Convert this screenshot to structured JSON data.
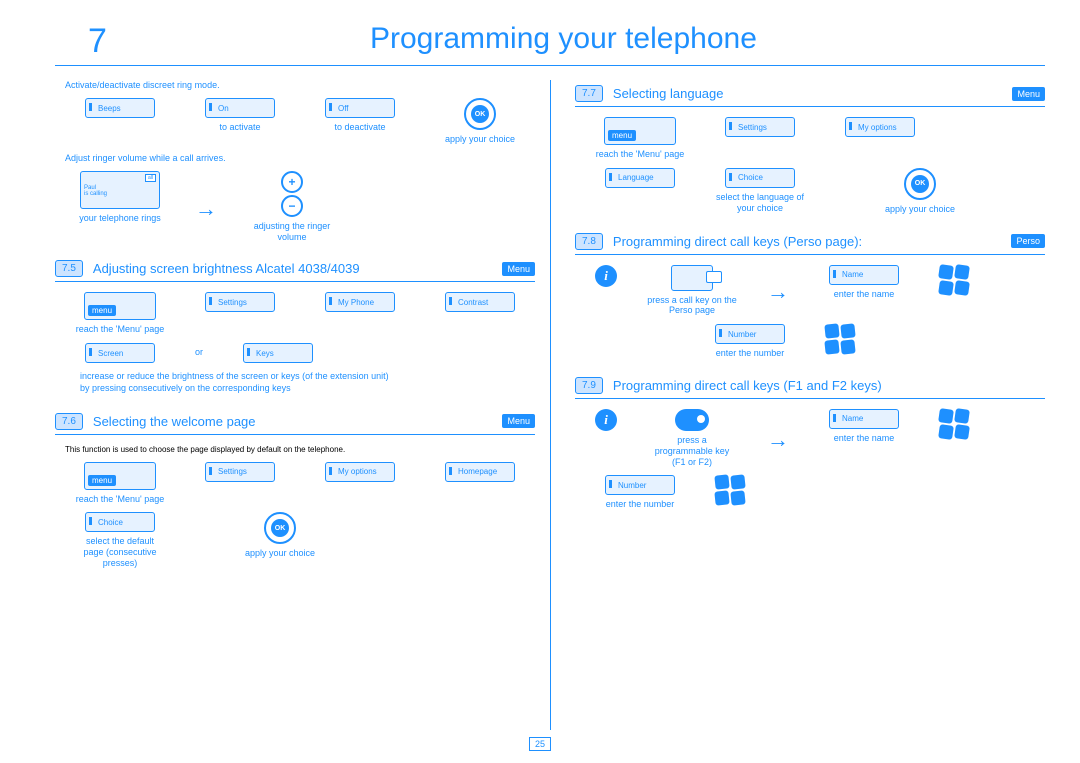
{
  "chapter": {
    "number": "7",
    "title": "Programming your telephone"
  },
  "page_number": "25",
  "left": {
    "note1": "Activate/deactivate discreet ring mode.",
    "r1": {
      "beeps": "Beeps",
      "on": "On",
      "off": "Off",
      "ok": "OK",
      "cap1": "to activate",
      "cap2": "to deactivate",
      "cap3": "apply your choice"
    },
    "note2": "Adjust ringer volume while a call arrives.",
    "r2": {
      "caller": "Paul\nis calling",
      "tab": "all",
      "cap1": "your telephone rings",
      "cap2": "adjusting the ringer volume"
    },
    "s75": {
      "num": "7.5",
      "title": "Adjusting screen brightness Alcatel 4038/4039",
      "tag": "Menu",
      "menu": "menu",
      "reach": "reach the 'Menu' page",
      "k1": "Settings",
      "k2": "My Phone",
      "k3": "Contrast",
      "k4": "Screen",
      "k5": "Keys",
      "or": "or",
      "desc": "increase or reduce the brightness of the screen or keys (of the extension unit) by pressing consecutively on the corresponding keys"
    },
    "s76": {
      "num": "7.6",
      "title": "Selecting the welcome page",
      "tag": "Menu",
      "desc": "This function is used to choose the page displayed by default on the telephone.",
      "menu": "menu",
      "reach": "reach the 'Menu' page",
      "k1": "Settings",
      "k2": "My options",
      "k3": "Homepage",
      "k4": "Choice",
      "cap1": "select the default page (consecutive presses)",
      "cap2": "apply your choice",
      "ok": "OK"
    }
  },
  "right": {
    "s77": {
      "num": "7.7",
      "title": "Selecting language",
      "tag": "Menu",
      "menu": "menu",
      "reach": "reach the 'Menu' page",
      "k1": "Settings",
      "k2": "My options",
      "k3": "Language",
      "k4": "Choice",
      "cap1": "select the language of your choice",
      "cap2": "apply your choice",
      "ok": "OK"
    },
    "s78": {
      "num": "7.8",
      "title": "Programming direct call keys (Perso page):",
      "tag": "Perso",
      "cap1": "press a call key on the Perso page",
      "k1": "Name",
      "cap2": "enter the name",
      "k2": "Number",
      "cap3": "enter the number"
    },
    "s79": {
      "num": "7.9",
      "title": "Programming direct call keys (F1 and F2 keys)",
      "cap1": "press a programmable key (F1 or F2)",
      "k1": "Name",
      "cap2": "enter the name",
      "k2": "Number",
      "cap3": "enter the number"
    }
  }
}
